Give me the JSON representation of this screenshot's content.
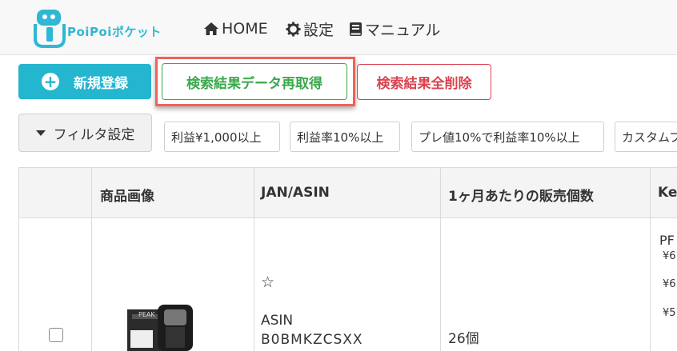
{
  "header": {
    "logo_text": "PoiPoiポケット",
    "nav": [
      {
        "label": "HOME",
        "icon": "home-icon"
      },
      {
        "label": "設定",
        "icon": "gear-icon"
      },
      {
        "label": "マニュアル",
        "icon": "book-icon"
      }
    ]
  },
  "actions": {
    "new_label": "新規登録",
    "refetch_label": "検索結果データ再取得",
    "delete_label": "検索結果全削除"
  },
  "filter": {
    "toggle_label": "フィルタ設定",
    "presets": [
      "利益¥1,000以上",
      "利益率10%以上",
      "プレ値10%で利益率10%以上",
      "カスタムフ"
    ]
  },
  "table": {
    "headers": [
      "",
      "商品画像",
      "JAN/ASIN",
      "1ヶ月あたりの販売個数",
      "Ke"
    ],
    "rows": [
      {
        "star": "☆",
        "asin_label": "ASIN",
        "asin_value": "B0BMKZCSXX",
        "monthly_sales": "26個",
        "keepa_title": "PF",
        "keepa_prices": [
          "¥6",
          "¥6",
          "¥5"
        ],
        "image_brand_text": "PEAK"
      }
    ]
  },
  "colors": {
    "primary": "#24b5cf",
    "success": "#3aa84c",
    "danger": "#d9434f",
    "highlight": "#f0625a"
  }
}
